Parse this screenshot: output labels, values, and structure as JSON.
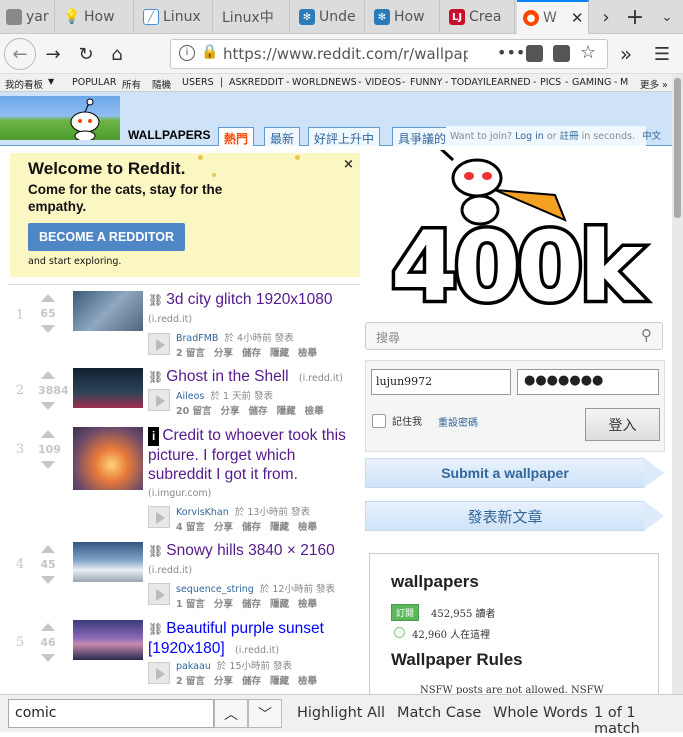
{
  "tabs": [
    {
      "label": "yar",
      "icon": "globe-icon"
    },
    {
      "label": "How",
      "icon": "lightbulb-icon"
    },
    {
      "label": "Linux",
      "icon": "pencil-icon"
    },
    {
      "label": "Linux中",
      "icon": ""
    },
    {
      "label": "Unde",
      "icon": "snowflake-icon"
    },
    {
      "label": "How",
      "icon": "snowflake-icon"
    },
    {
      "label": "Crea",
      "icon": "lj-icon"
    },
    {
      "label": "W",
      "icon": "reddit-icon",
      "active": true
    }
  ],
  "url": "https://www.reddit.com/r/wallpape",
  "srbar": {
    "my_subreddits": "我的看板",
    "items": [
      "POPULAR",
      "所有",
      "隨機",
      "USERS",
      "|",
      "ASKREDDIT",
      "-",
      "WORLDNEWS",
      "-",
      "VIDEOS",
      "-",
      "FUNNY",
      "-",
      "TODAYILEARNED",
      "-",
      "PICS",
      "-",
      "GAMING",
      "-",
      "M"
    ],
    "more": "更多 »"
  },
  "header": {
    "subreddit": "WALLPAPERS",
    "tabs": [
      "熱門",
      "最新",
      "好評上升中",
      "具爭議的"
    ],
    "join_text": "Want to join?",
    "login_text": "Log in",
    "or_text": "or",
    "register_text": "註冊",
    "seconds_text": "in seconds.",
    "lang": "中文"
  },
  "welcome": {
    "title": "Welcome to Reddit.",
    "subtitle": "Come for the cats, stay for the empathy.",
    "button": "BECOME A REDDITOR",
    "explore": "and start exploring.",
    "close": "×"
  },
  "posts": [
    {
      "rank": "1",
      "score": "65",
      "title": "3d city glitch 1920x1080",
      "domain": "(i.redd.it)",
      "author": "BradFMB",
      "time": "於 4小時前 發表",
      "comments": "2 留言",
      "flair_icon": "link-icon"
    },
    {
      "rank": "2",
      "score": "3884",
      "title": "Ghost in the Shell",
      "domain": "(i.redd.it)",
      "author": "Aileos",
      "time": "於 1 天前 發表",
      "comments": "20 留言",
      "flair_icon": "link-icon"
    },
    {
      "rank": "3",
      "score": "109",
      "title": "Credit to whoever took this picture. I forget which subreddit I got it from.",
      "domain": "(i.imgur.com)",
      "author": "KorvisKhan",
      "time": "於 13小時前 發表",
      "comments": "4 留言",
      "flair_icon": "info-icon"
    },
    {
      "rank": "4",
      "score": "45",
      "title": "Snowy hills 3840 × 2160",
      "domain": "(i.redd.it)",
      "author": "sequence_string",
      "time": "於 12小時前 發表",
      "comments": "1 留言",
      "flair_icon": "link-icon"
    },
    {
      "rank": "5",
      "score": "46",
      "title": "Beautiful purple sunset [1920x180]",
      "domain": "(i.redd.it)",
      "author": "pakaau",
      "time": "於 15小時前 發表",
      "comments": "2 留言",
      "flair_icon": "link-icon"
    }
  ],
  "post_actions": [
    "分享",
    "儲存",
    "隱藏",
    "檢舉"
  ],
  "sidebar": {
    "banner_text": "400k",
    "search_placeholder": "搜尋",
    "username": "lujun9972",
    "password": "●●●●●●●",
    "remember": "記住我",
    "forgot": "重設密碼",
    "login_button": "登入",
    "submit_link": "Submit a wallpaper",
    "submit_text": "發表新文章",
    "subreddit_name": "wallpapers",
    "subscribe": "訂閱",
    "readers": "452,955 讀者",
    "online": "42,960 人在這裡",
    "rules_title": "Wallpaper Rules",
    "rules_first": "NSFW posts are not allowed. NSFW"
  },
  "findbar": {
    "query": "comic",
    "highlight_all": "Highlight All",
    "match_case": "Match Case",
    "whole_words": "Whole Words",
    "result": "1 of 1 match"
  }
}
